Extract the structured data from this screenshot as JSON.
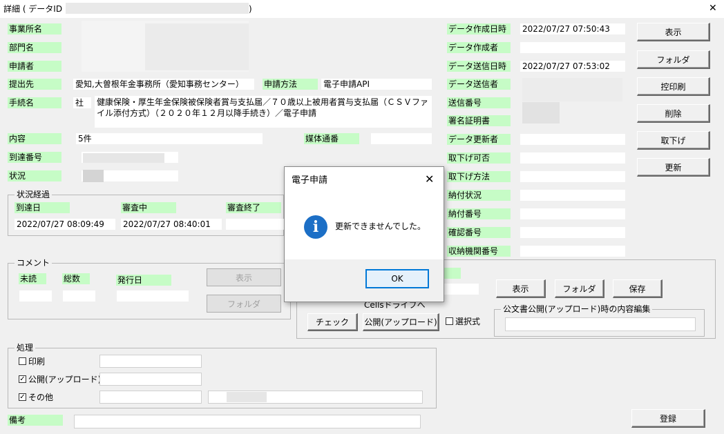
{
  "window": {
    "title": "詳細 ( データID :",
    "title_suffix": ")",
    "close_glyph": "✕"
  },
  "left": {
    "jigyosho_label": "事業所名",
    "bumon_label": "部門名",
    "shinseisha_label": "申請者",
    "teishutsusaki_label": "提出先",
    "teishutsusaki_value": "愛知,大曽根年金事務所（愛知事務センター）",
    "shinsei_houhou_label": "申請方法",
    "shinsei_houhou_value": "電子申請API",
    "tetsuzuki_label": "手続名",
    "tetsuzuki_prefix": "社",
    "tetsuzuki_value": "健康保険・厚生年金保険被保険者賞与支払届／７０歳以上被用者賞与支払届（ＣＳＶファイル添付方式）（２０２０年１２月以降手続き）／電子申請",
    "naiyou_label": "内容",
    "naiyou_value": "5件",
    "baitai_label": "媒体通番",
    "totatsu_label": "到達番号",
    "joukyou_label": "状況"
  },
  "status_group": {
    "title": "状況経過",
    "arrival_label": "到達日",
    "review_label": "審査中",
    "review_done_label": "審査終了",
    "arrival_value": "2022/07/27 08:09:49",
    "review_value": "2022/07/27 08:40:01"
  },
  "comment_group": {
    "title": "コメント",
    "unread_label": "未読",
    "total_label": "総数",
    "issue_date_label": "発行日",
    "show_button": "表示",
    "folder_button": "フォルダ"
  },
  "right": {
    "created_at_label": "データ作成日時",
    "created_at_value": "2022/07/27 07:50:43",
    "creator_label": "データ作成者",
    "sent_at_label": "データ送信日時",
    "sent_at_value": "2022/07/27 07:53:02",
    "sender_label": "データ送信者",
    "send_no_label": "送信番号",
    "cert_label": "署名証明書",
    "updater_label": "データ更新者",
    "withdraw_ok_label": "取下げ可否",
    "withdraw_method_label": "取下げ方法",
    "payment_status_label": "納付状況",
    "payment_no_label": "納付番号",
    "confirm_no_label": "確認番号",
    "agency_no_label": "収納機関番号"
  },
  "buttons": {
    "show": "表示",
    "folder": "フォルダ",
    "copy_print": "控印刷",
    "delete": "削除",
    "withdraw": "取下げ",
    "update": "更新",
    "register": "登録"
  },
  "cells_group": {
    "drive_label": "Cellsドライブへ",
    "check_button": "チェック",
    "publish_button": "公開(アップロード)",
    "select_label": "選択式",
    "show_button": "表示",
    "folder_button": "フォルダ",
    "save_button": "保存",
    "edit_title": "公文書公開(アップロード)時の内容編集"
  },
  "process_group": {
    "title": "処理",
    "print_label": "印刷",
    "publish_label": "公開(アップロード)",
    "other_label": "その他",
    "check_glyph": "✓"
  },
  "bikou_label": "備考",
  "dialog": {
    "title": "電子申請",
    "message": "更新できませんでした。",
    "ok_button": "OK",
    "close_glyph": "✕",
    "icon_glyph": "i"
  },
  "colors": {
    "label_bg": "#c6fcc6",
    "info_icon": "#1c6fc6",
    "ok_border": "#0078d7"
  }
}
